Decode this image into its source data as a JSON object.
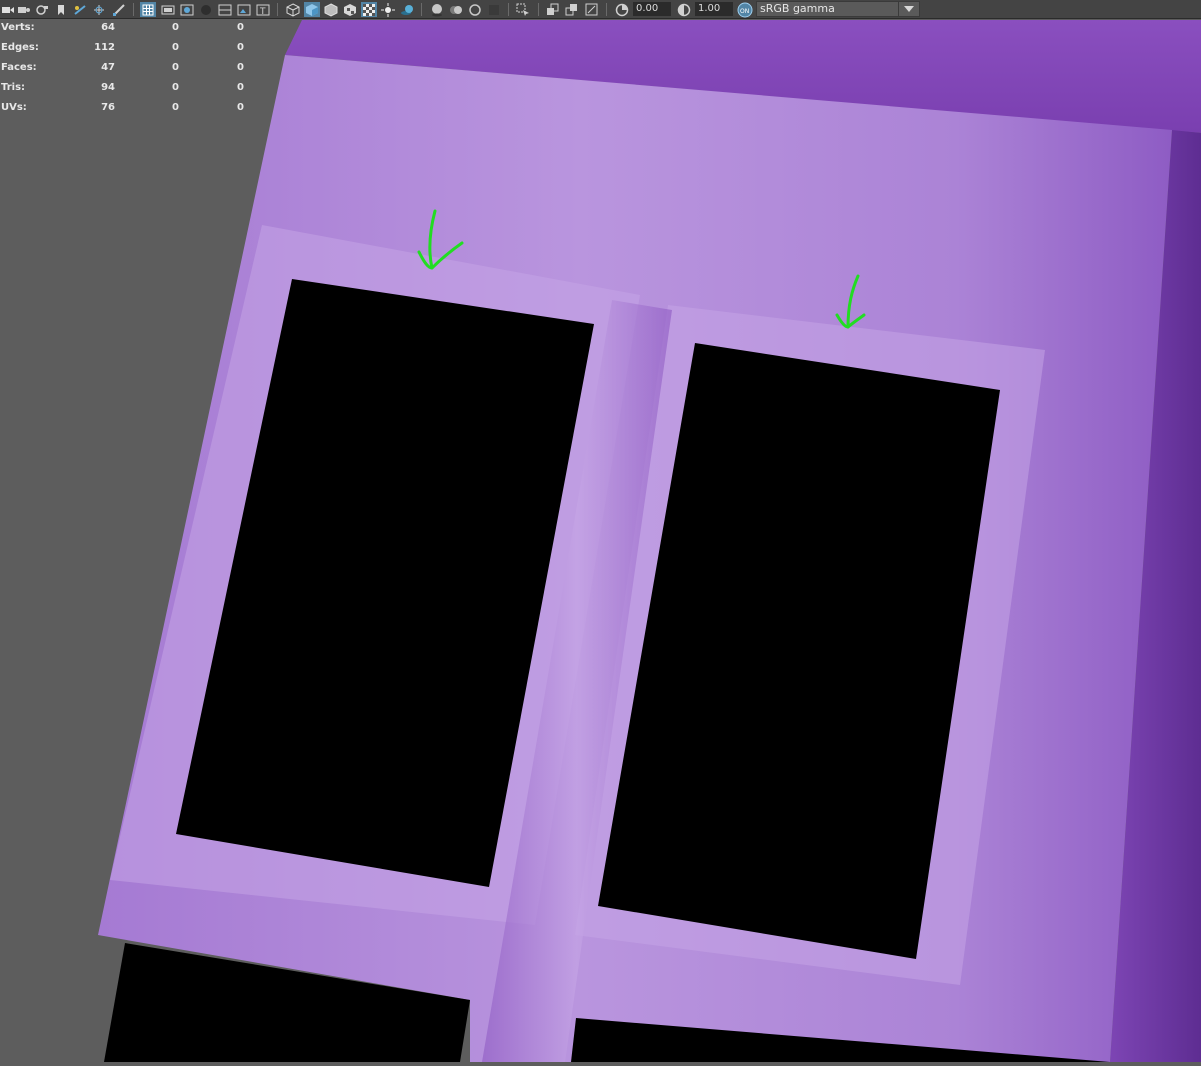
{
  "toolbar": {
    "exposure_value": "0.00",
    "gamma_value": "1.00",
    "color_space": "sRGB gamma",
    "accent_color": "#5285a6"
  },
  "stats": {
    "rows": [
      {
        "label": "Verts:",
        "v1": "64",
        "v2": "0",
        "v3": "0"
      },
      {
        "label": "Edges:",
        "v1": "112",
        "v2": "0",
        "v3": "0"
      },
      {
        "label": "Faces:",
        "v1": "47",
        "v2": "0",
        "v3": "0"
      },
      {
        "label": "Tris:",
        "v1": "94",
        "v2": "0",
        "v3": "0"
      },
      {
        "label": "UVs:",
        "v1": "76",
        "v2": "0",
        "v3": "0"
      }
    ]
  },
  "viewport": {
    "background_color": "#5d5d5d",
    "mesh_color": "#a77bd0",
    "annotation_color": "#22dd22"
  },
  "icons": [
    "camera-icon",
    "bookmark-icon",
    "grid-icon",
    "wireframe-icon",
    "shaded-icon",
    "textured-icon",
    "lights-icon",
    "xray-icon",
    "exposure-icon",
    "gamma-icon",
    "color-management-icon"
  ]
}
